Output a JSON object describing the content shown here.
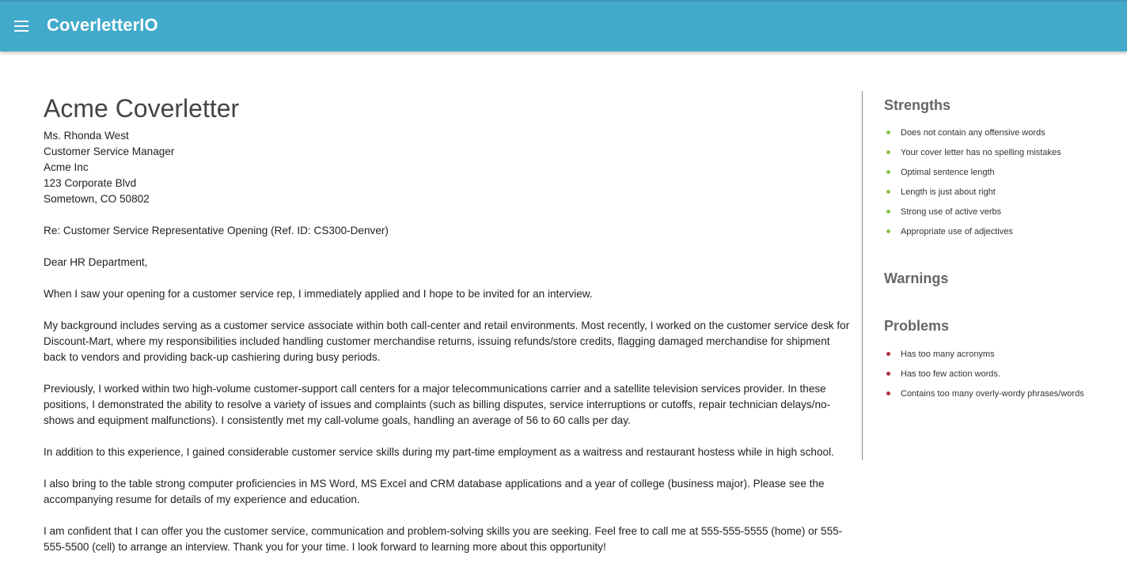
{
  "appbar": {
    "menu_icon": "hamburger-menu-icon",
    "title": "CoverletterIO",
    "color": "#42aacb"
  },
  "letter": {
    "title": "Acme Coverletter",
    "address": [
      "Ms. Rhonda West",
      "Customer Service Manager",
      "Acme Inc",
      "123 Corporate Blvd",
      "Sometown, CO 50802"
    ],
    "re_line": "Re: Customer Service Representative Opening (Ref. ID: CS300-Denver)",
    "salutation": "Dear HR Department,",
    "paragraphs": [
      "When I saw your opening for a customer service rep, I immediately applied and I hope to be invited for an interview.",
      "My background includes serving as a customer service associate within both call-center and retail environments. Most recently, I worked on the customer service desk for Discount-Mart, where my responsibilities included handling customer merchandise returns, issuing refunds/store credits, flagging damaged merchandise for shipment back to vendors and providing back-up cashiering during busy periods.",
      "Previously, I worked within two high-volume customer-support call centers for a major telecommunications carrier and a satellite television services provider. In these positions, I demonstrated the ability to resolve a variety of issues and complaints (such as billing disputes, service interruptions or cutoffs, repair technician delays/no-shows and equipment malfunctions). I consistently met my call-volume goals, handling an average of 56 to 60 calls per day.",
      "In addition to this experience, I gained considerable customer service skills during my part-time employment as a waitress and restaurant hostess while in high school.",
      "I also bring to the table strong computer proficiencies in MS Word, MS Excel and CRM database applications and a year of college (business major). Please see the accompanying resume for details of my experience and education.",
      "I am confident that I can offer you the customer service, communication and problem-solving skills you are seeking. Feel free to call me at 555-555-5555 (home) or 555-555-5500 (cell) to arrange an interview. Thank you for your time. I look forward to learning more about this opportunity!"
    ]
  },
  "sidebar": {
    "strengths": {
      "title": "Strengths",
      "color": "#8bc34a",
      "items": [
        "Does not contain any offensive words",
        "Your cover letter has no spelling mistakes",
        "Optimal sentence length",
        "Length is just about right",
        "Strong use of active verbs",
        "Appropriate use of adjectives"
      ]
    },
    "warnings": {
      "title": "Warnings",
      "items": []
    },
    "problems": {
      "title": "Problems",
      "color": "#b03040",
      "items": [
        "Has too many acronyms",
        "Has too few action words.",
        "Contains too many overly-wordy phrases/words"
      ]
    }
  }
}
